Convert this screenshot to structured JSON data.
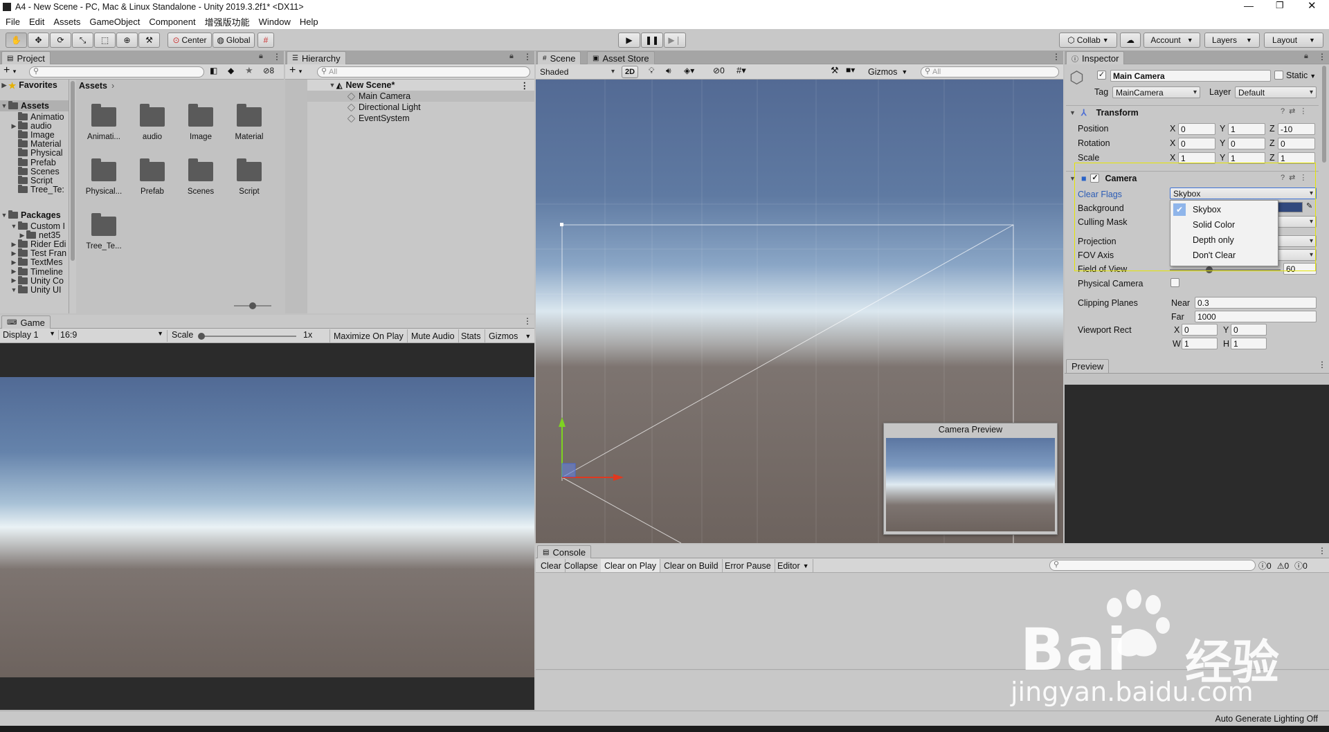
{
  "window": {
    "title": "A4 - New Scene - PC, Mac & Linux Standalone - Unity 2019.3.2f1* <DX11>"
  },
  "menu": [
    "File",
    "Edit",
    "Assets",
    "GameObject",
    "Component",
    "增强版功能",
    "Window",
    "Help"
  ],
  "toolbar": {
    "center": "Center",
    "global": "Global",
    "collab": "Collab",
    "account": "Account",
    "layers": "Layers",
    "layout": "Layout"
  },
  "project": {
    "tab": "Project",
    "hidden_count": "8",
    "favorites": "Favorites",
    "assets": "Assets",
    "packages": "Packages",
    "breadcrumb": "Assets",
    "tree_assets": [
      "Animatio",
      "audio",
      "Image",
      "Material",
      "Physical",
      "Prefab",
      "Scenes",
      "Script",
      "Tree_Te:"
    ],
    "tree_packages": [
      "Custom I",
      "net35",
      "Rider Edi",
      "Test Fran",
      "TextMes",
      "Timeline",
      "Unity Co",
      "Unity UI"
    ],
    "folders": [
      "Animati...",
      "audio",
      "Image",
      "Material",
      "Physical...",
      "Prefab",
      "Scenes",
      "Script",
      "Tree_Te..."
    ]
  },
  "hierarchy": {
    "tab": "Hierarchy",
    "search": "All",
    "scene": "New Scene*",
    "items": [
      "Main Camera",
      "Directional Light",
      "EventSystem"
    ]
  },
  "scene": {
    "tab": "Scene",
    "tab2": "Asset Store",
    "shading": "Shaded",
    "mode2d": "2D",
    "hidden": "0",
    "gizmos": "Gizmos",
    "search": "All",
    "preview_title": "Camera Preview"
  },
  "game": {
    "tab": "Game",
    "display": "Display 1",
    "aspect": "16:9",
    "scale_label": "Scale",
    "scale_value": "1x",
    "maximize": "Maximize On Play",
    "mute": "Mute Audio",
    "stats": "Stats",
    "gizmos": "Gizmos"
  },
  "inspector": {
    "tab": "Inspector",
    "name": "Main Camera",
    "static": "Static",
    "tag_label": "Tag",
    "tag": "MainCamera",
    "layer_label": "Layer",
    "layer": "Default",
    "transform": {
      "title": "Transform",
      "position": "Position",
      "rotation": "Rotation",
      "scale": "Scale",
      "pos": [
        "0",
        "1",
        "-10"
      ],
      "rot": [
        "0",
        "0",
        "0"
      ],
      "scl": [
        "1",
        "1",
        "1"
      ]
    },
    "camera": {
      "title": "Camera",
      "clear_flags": "Clear Flags",
      "clear_value": "Skybox",
      "background": "Background",
      "culling": "Culling Mask",
      "projection": "Projection",
      "fov_axis": "FOV Axis",
      "fov": "Field of View",
      "fov_value": "60",
      "physical": "Physical Camera",
      "clipping": "Clipping Planes",
      "near_label": "Near",
      "near": "0.3",
      "far_label": "Far",
      "far": "1000",
      "viewport": "Viewport Rect",
      "vx": "0",
      "vy": "0",
      "vw": "1",
      "vh": "1"
    },
    "dropdown": [
      "Skybox",
      "Solid Color",
      "Depth only",
      "Don't Clear"
    ],
    "preview": "Preview"
  },
  "console": {
    "tab": "Console",
    "buttons": [
      "Clear",
      "Collapse",
      "Clear on Play",
      "Clear on Build",
      "Error Pause",
      "Editor"
    ],
    "counts": [
      "0",
      "0",
      "0"
    ]
  },
  "status": {
    "right": "Auto Generate Lighting Off"
  },
  "watermark": {
    "brand": "Bai",
    "cn": "经验",
    "url": "jingyan.baidu.com"
  },
  "xyz": [
    "X",
    "Y",
    "Z"
  ],
  "wh": [
    "W",
    "H"
  ]
}
